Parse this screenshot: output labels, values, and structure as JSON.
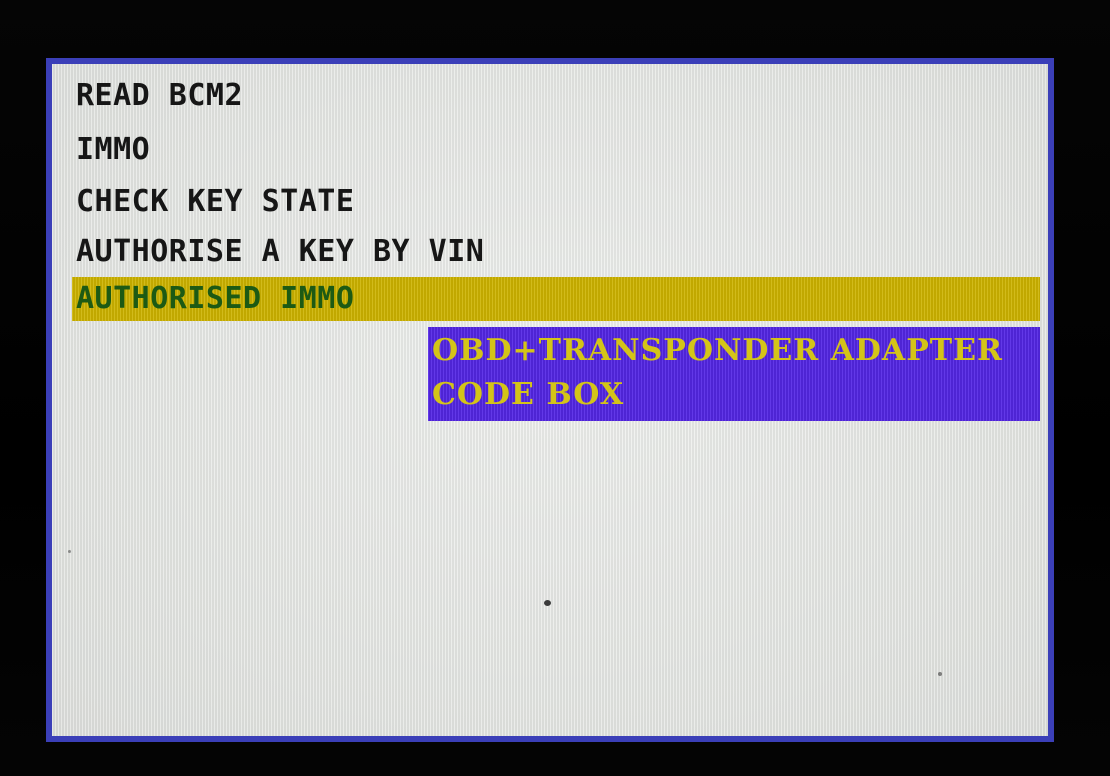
{
  "menu": {
    "items": [
      {
        "label": "READ BCM2"
      },
      {
        "label": "IMMO"
      },
      {
        "label": "CHECK KEY STATE"
      },
      {
        "label": "AUTHORISE A KEY BY VIN"
      },
      {
        "label": "AUTHORISED IMMO",
        "selected": true
      }
    ]
  },
  "submenu": {
    "items": [
      {
        "label": "OBD+TRANSPONDER ADAPTER"
      },
      {
        "label": "CODE BOX"
      }
    ]
  },
  "colors": {
    "screen_background": "#e7e9e6",
    "border": "#3b3fb8",
    "menu_text": "#161616",
    "selected_background": "#cdb300",
    "selected_text": "#1d5a14",
    "submenu_background": "#5527e6",
    "submenu_text": "#d4c418"
  }
}
